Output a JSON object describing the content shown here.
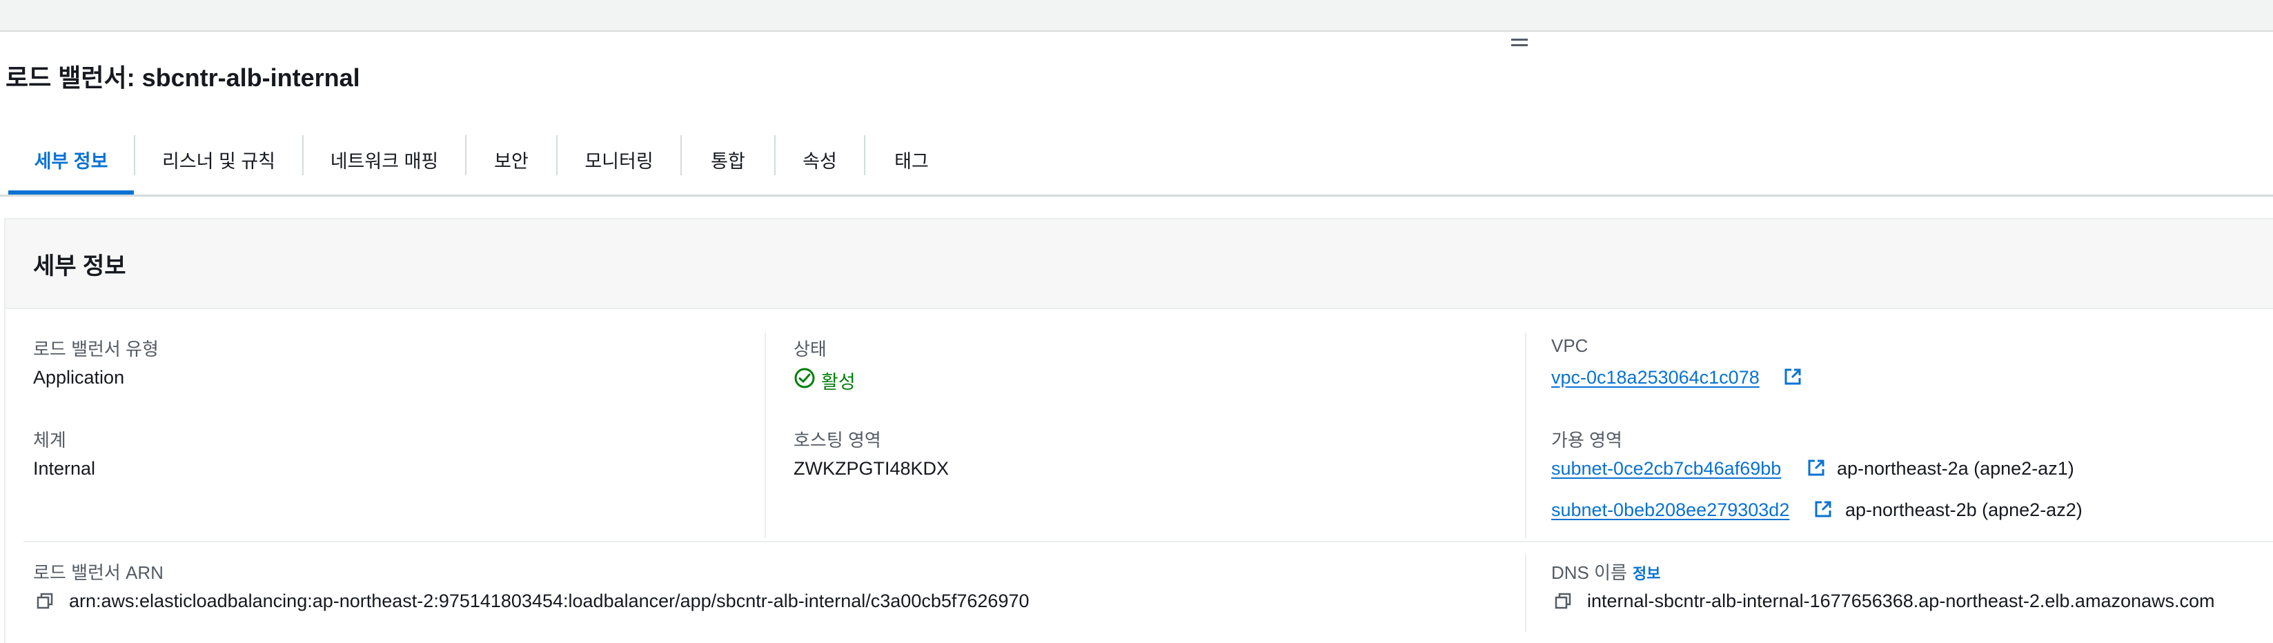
{
  "page": {
    "title": "로드 밸런서: sbcntr-alb-internal"
  },
  "tabs": [
    {
      "label": "세부 정보",
      "active": true
    },
    {
      "label": "리스너 및 규칙"
    },
    {
      "label": "네트워크 매핑"
    },
    {
      "label": "보안"
    },
    {
      "label": "모니터링"
    },
    {
      "label": "통합"
    },
    {
      "label": "속성"
    },
    {
      "label": "태그"
    }
  ],
  "details": {
    "section_title": "세부 정보",
    "lb_type_label": "로드 밸런서 유형",
    "lb_type_value": "Application",
    "status_label": "상태",
    "status_value": "활성",
    "vpc_label": "VPC",
    "vpc_value": "vpc-0c18a253064c1c078",
    "scheme_label": "체계",
    "scheme_value": "Internal",
    "hosted_zone_label": "호스팅 영역",
    "hosted_zone_value": "ZWKZPGTI48KDX",
    "az_label": "가용 영역",
    "subnets": [
      {
        "id": "subnet-0ce2cb7cb46af69bb",
        "zone": "ap-northeast-2a (apne2-az1)"
      },
      {
        "id": "subnet-0beb208ee279303d2",
        "zone": "ap-northeast-2b (apne2-az2)"
      }
    ],
    "arn_label": "로드 밸런서 ARN",
    "arn_value": "arn:aws:elasticloadbalancing:ap-northeast-2:975141803454:loadbalancer/app/sbcntr-alb-internal/c3a00cb5f7626970",
    "dns_label": "DNS 이름",
    "dns_info": "정보",
    "dns_value": "internal-sbcntr-alb-internal-1677656368.ap-northeast-2.elb.amazonaws.com"
  },
  "colors": {
    "link": "#0972d3",
    "success": "#037f0c",
    "text": "#16191f",
    "muted": "#545b64"
  },
  "icons": {
    "status": "check-circle-icon",
    "external": "external-link-icon",
    "copy": "copy-icon",
    "handle": "drag-handle-icon"
  }
}
